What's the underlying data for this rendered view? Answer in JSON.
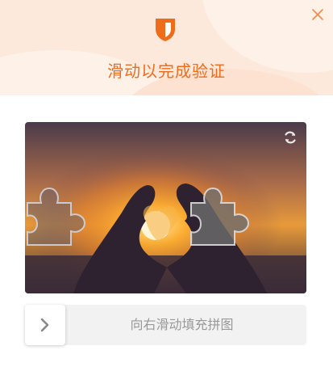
{
  "header": {
    "title": "滑动以完成验证",
    "icons": {
      "shield": "shield-icon",
      "close": "close-icon"
    }
  },
  "captcha": {
    "refresh_icon": "refresh-icon",
    "image": "silhouette hands forming heart around sun at sunset",
    "slider": {
      "hint": "向右滑动填充拼图",
      "handle_icon": "chevron-right-icon",
      "position": 0
    }
  },
  "colors": {
    "accent": "#ef6c1a",
    "header_bg": "#fde9dc",
    "slider_track": "#f2f2f2",
    "hint_text": "#999999"
  }
}
